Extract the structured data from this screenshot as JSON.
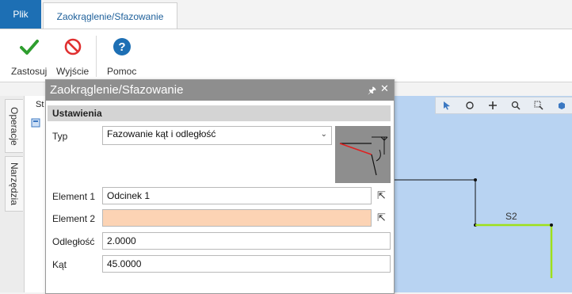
{
  "tabs": {
    "file": "Plik",
    "active": "Zaokrąglenie/Sfazowanie"
  },
  "ribbon": {
    "apply": "Zastosuj",
    "exit": "Wyjście",
    "help": "Pomoc"
  },
  "side_tabs": {
    "operations": "Operacje",
    "tools": "Narzędzia"
  },
  "tree": {
    "col": "St"
  },
  "dialog": {
    "title": "Zaokrąglenie/Sfazowanie",
    "group": "Ustawienia",
    "type_label": "Typ",
    "type_value": "Fazowanie kąt i odległość",
    "element1_label": "Element 1",
    "element1_value": "Odcinek 1",
    "element2_label": "Element 2",
    "element2_value": "",
    "distance_label": "Odległość",
    "distance_value": "2.0000",
    "angle_label": "Kąt",
    "angle_value": "45.0000"
  },
  "canvas": {
    "segment_label": "S2"
  },
  "colors": {
    "accent": "#1d6fb4",
    "highlight_field": "#fcd3b4",
    "canvas_bg": "#b8d3f2",
    "segment": "#9ee01a"
  }
}
